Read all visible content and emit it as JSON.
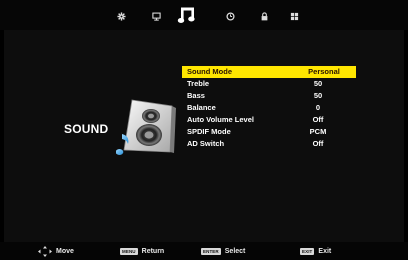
{
  "tabs": [
    {
      "icon": "picture-icon"
    },
    {
      "icon": "channel-icon"
    },
    {
      "icon": "sound-icon",
      "active": true
    },
    {
      "icon": "time-icon"
    },
    {
      "icon": "lock-icon"
    },
    {
      "icon": "setup-icon"
    }
  ],
  "section": {
    "label": "SOUND",
    "icon": "speaker-icon"
  },
  "menu": {
    "items": [
      {
        "label": "Sound Mode",
        "value": "Personal",
        "selected": true
      },
      {
        "label": "Treble",
        "value": "50"
      },
      {
        "label": "Bass",
        "value": "50"
      },
      {
        "label": "Balance",
        "value": "0"
      },
      {
        "label": "Auto Volume Level",
        "value": "Off"
      },
      {
        "label": "SPDIF Mode",
        "value": "PCM"
      },
      {
        "label": "AD Switch",
        "value": "Off"
      }
    ]
  },
  "help": {
    "move": {
      "label": "Move"
    },
    "return": {
      "key": "MENU",
      "label": "Return"
    },
    "select": {
      "key": "ENTER",
      "label": "Select"
    },
    "exit": {
      "key": "EXIT",
      "label": "Exit"
    }
  },
  "colors": {
    "highlight": "#ffe600",
    "highlight_text": "#2a1400",
    "background": "#000000"
  }
}
